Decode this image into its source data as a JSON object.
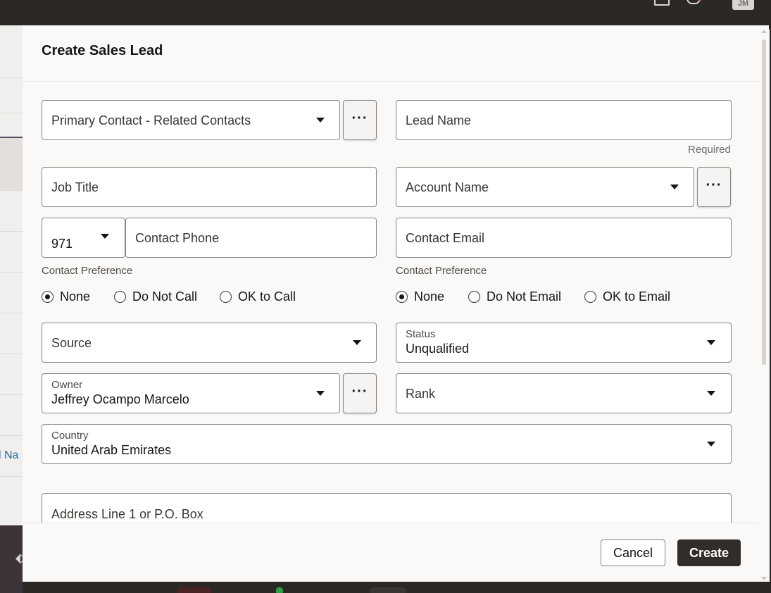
{
  "dialog": {
    "title": "Create Sales Lead"
  },
  "fields": {
    "primary_contact": {
      "label": "Primary Contact - Related Contacts"
    },
    "lead_name": {
      "label": "Lead Name",
      "hint": "Required"
    },
    "job_title": {
      "label": "Job Title"
    },
    "account_name": {
      "label": "Account Name"
    },
    "country_code": {
      "value": "971"
    },
    "contact_phone": {
      "label": "Contact Phone"
    },
    "contact_email": {
      "label": "Contact Email"
    },
    "source": {
      "label": "Source"
    },
    "status": {
      "label": "Status",
      "value": "Unqualified"
    },
    "owner": {
      "label": "Owner",
      "value": "Jeffrey Ocampo Marcelo"
    },
    "rank": {
      "label": "Rank"
    },
    "country": {
      "label": "Country",
      "value": "United Arab Emirates"
    },
    "address_line1": {
      "label": "Address Line 1 or P.O. Box"
    }
  },
  "phone_pref": {
    "label": "Contact Preference",
    "options": [
      "None",
      "Do Not Call",
      "OK to Call"
    ],
    "selected": "None"
  },
  "email_pref": {
    "label": "Contact Preference",
    "options": [
      "None",
      "Do Not Email",
      "OK to Email"
    ],
    "selected": "None"
  },
  "more_button": {
    "label": "···"
  },
  "footer": {
    "cancel_label": "Cancel",
    "create_label": "Create"
  },
  "background": {
    "fragment_text": "l Na",
    "avatar_initials": "JM"
  },
  "icons": [
    "notification-tray-icon",
    "bell-icon",
    "chevron-down-icon",
    "ellipsis-icon",
    "radio-icon"
  ],
  "colors": {
    "primary_button": "#312d2a",
    "header_bar": "#2b2825",
    "dialog_bg": "#fbf9f8",
    "link_text": "#2d6a8f"
  }
}
